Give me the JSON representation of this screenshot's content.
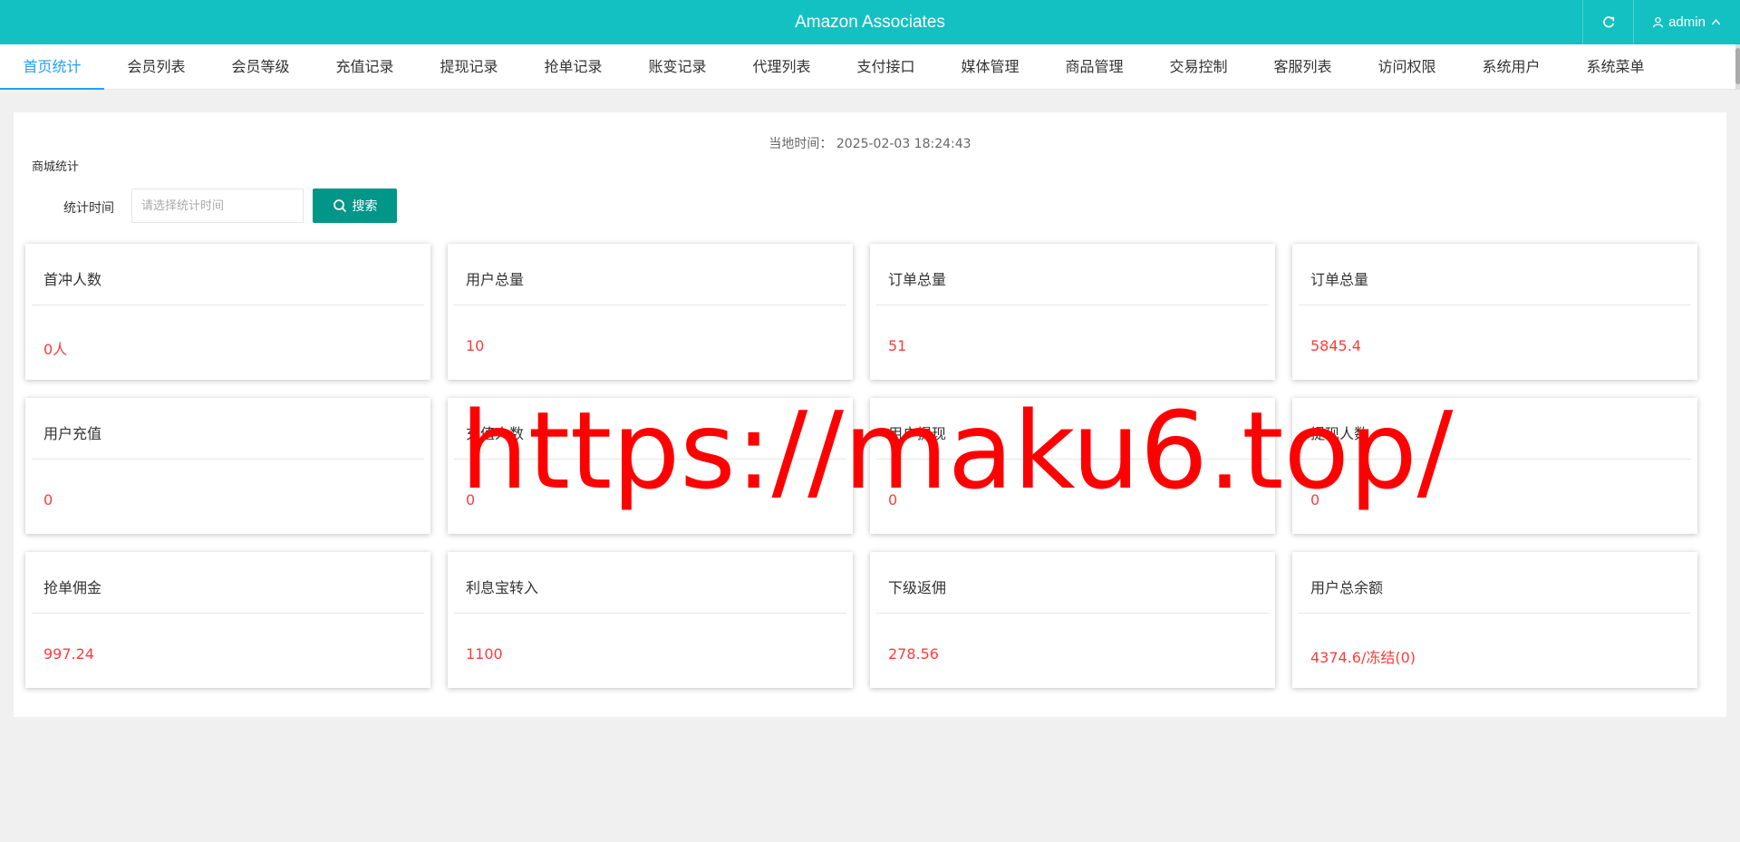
{
  "header": {
    "title": "Amazon Associates",
    "user": "admin",
    "accent_color": "#14c1c2"
  },
  "nav": {
    "tabs": [
      {
        "label": "首页统计",
        "active": true
      },
      {
        "label": "会员列表"
      },
      {
        "label": "会员等级"
      },
      {
        "label": "充值记录"
      },
      {
        "label": "提现记录"
      },
      {
        "label": "抢单记录"
      },
      {
        "label": "账变记录"
      },
      {
        "label": "代理列表"
      },
      {
        "label": "支付接口"
      },
      {
        "label": "媒体管理"
      },
      {
        "label": "商品管理"
      },
      {
        "label": "交易控制"
      },
      {
        "label": "客服列表"
      },
      {
        "label": "访问权限"
      },
      {
        "label": "系统用户"
      },
      {
        "label": "系统菜单"
      }
    ]
  },
  "main": {
    "local_time_label": "当地时间：",
    "local_time_value": "2025-02-03 18:24:43",
    "section_title": "商城统计",
    "filter": {
      "label": "统计时间",
      "placeholder": "请选择统计时间",
      "search_label": "搜索"
    },
    "cards": [
      {
        "title": "首冲人数",
        "value": "0人"
      },
      {
        "title": "用户总量",
        "value": "10"
      },
      {
        "title": "订单总量",
        "value": "51"
      },
      {
        "title": "订单总量",
        "value": "5845.4"
      },
      {
        "title": "用户充值",
        "value": "0"
      },
      {
        "title": "充值人数",
        "value": "0"
      },
      {
        "title": "用户提现",
        "value": "0"
      },
      {
        "title": "提现人数",
        "value": "0"
      },
      {
        "title": "抢单佣金",
        "value": "997.24"
      },
      {
        "title": "利息宝转入",
        "value": "1100"
      },
      {
        "title": "下级返佣",
        "value": "278.56"
      },
      {
        "title": "用户总余额",
        "value": "4374.6/冻结(0)"
      }
    ]
  },
  "watermark": "https://maku6.top/"
}
